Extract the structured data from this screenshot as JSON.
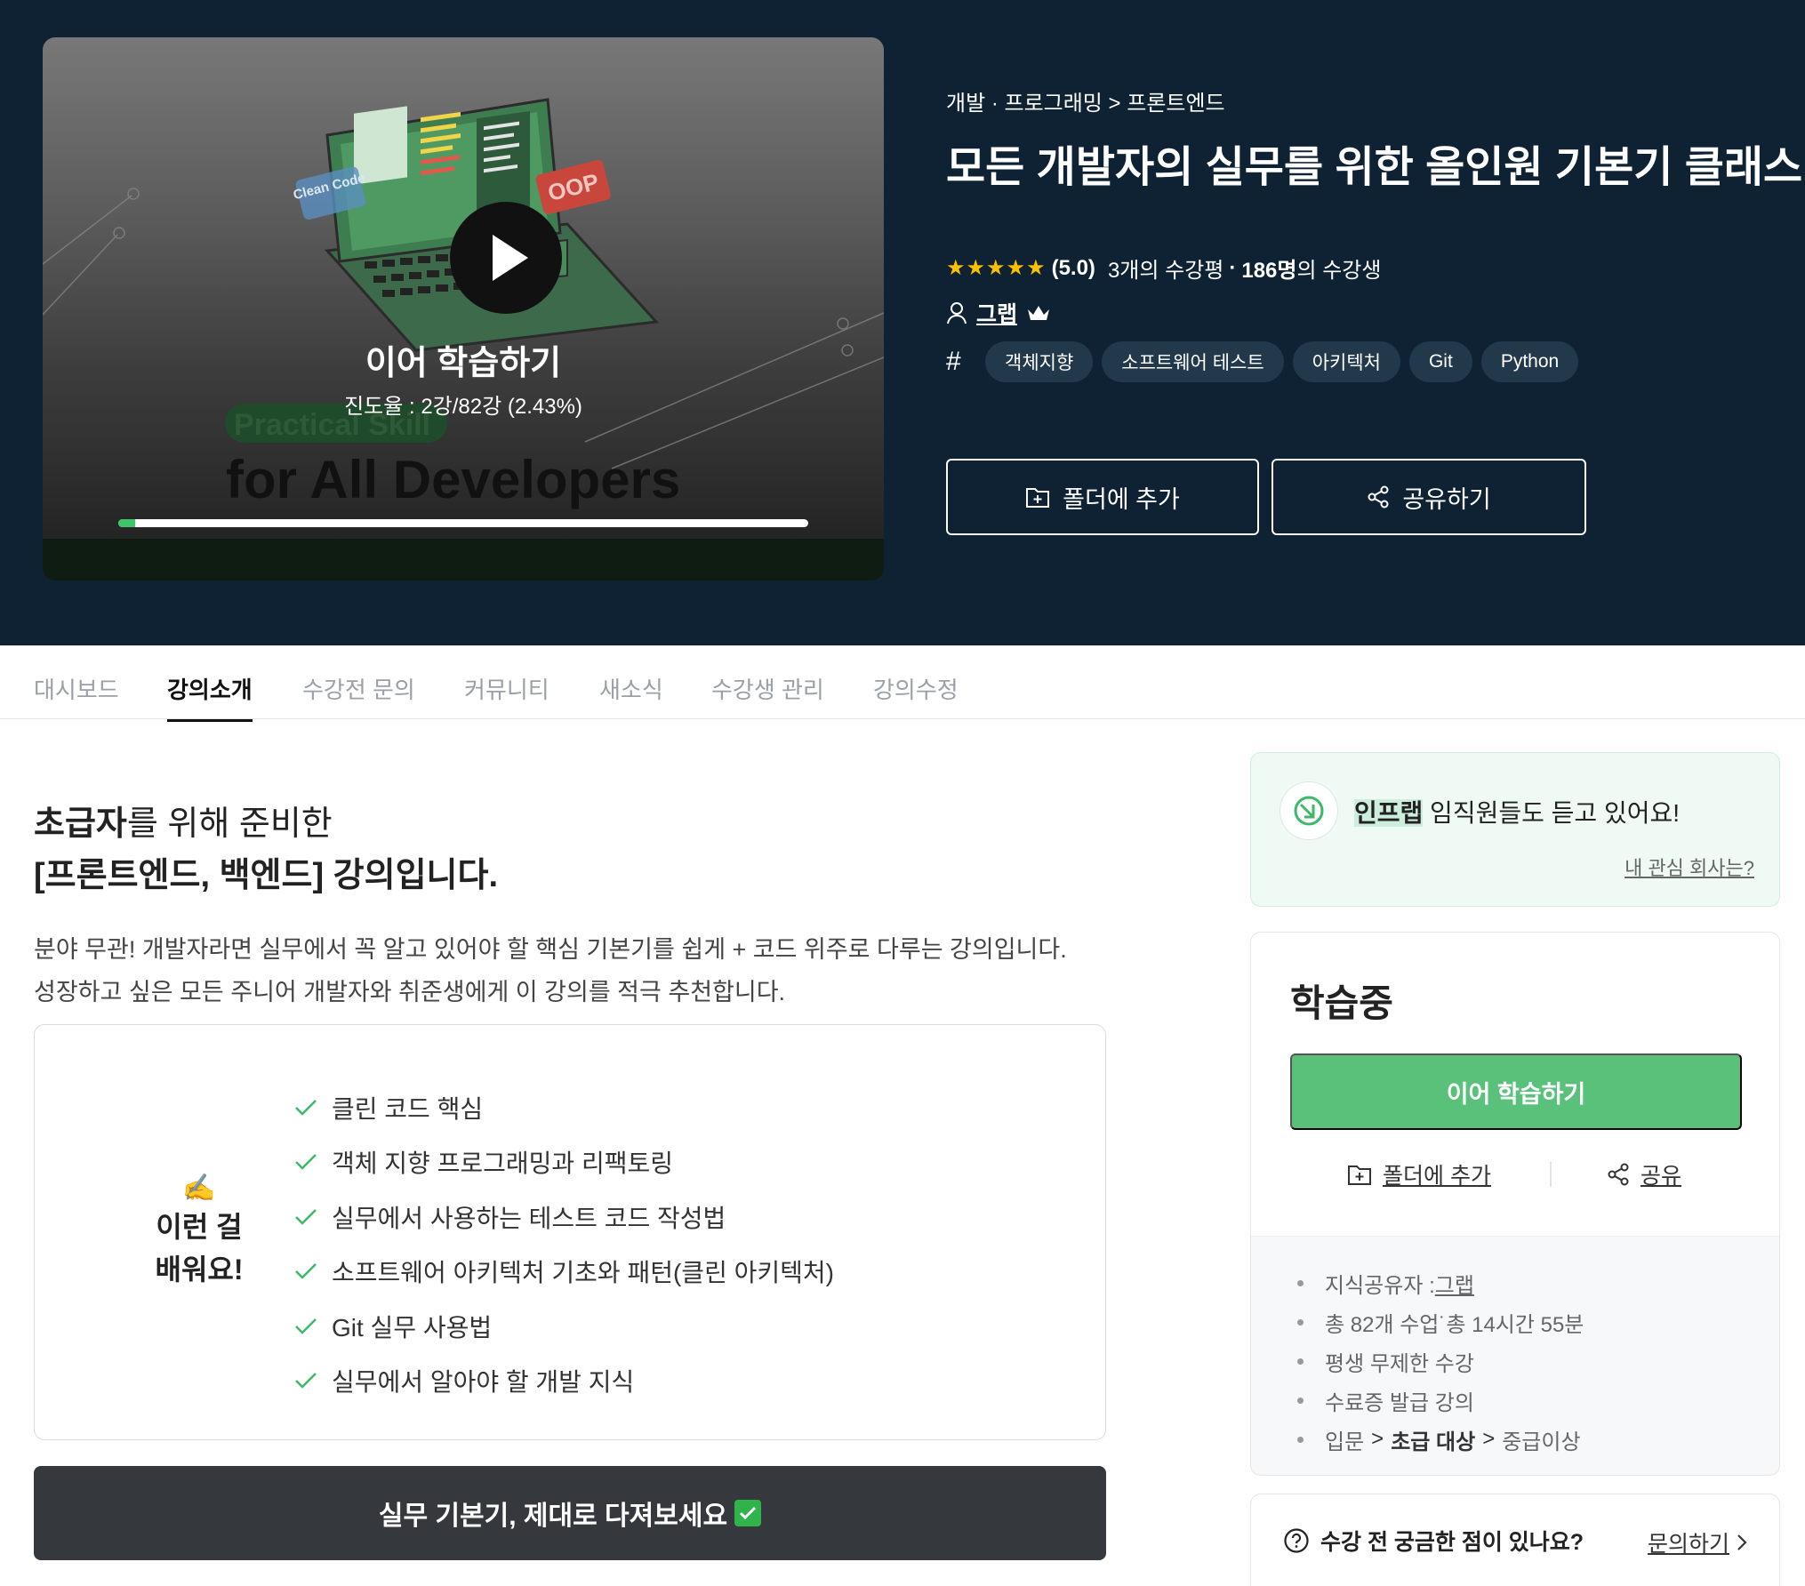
{
  "video": {
    "resume_title": "이어 학습하기",
    "progress_text": "진도율 : 2강/82강 (2.43%)",
    "progress_fraction": 0.0243,
    "art_tag_left": "Clean Code",
    "art_tag_right": "OOP",
    "art_subtitle": "Practical Skill",
    "art_title": "for All Developers"
  },
  "course": {
    "breadcrumb": "개발 · 프로그래밍 > 프론트엔드",
    "title": "모든 개발자의 실무를 위한 올인원 기본기 클래스",
    "stars": "★★★★★",
    "rating": "(5.0)",
    "reviews": "3개의 수강평",
    "dot": "·",
    "students_count": "186명",
    "students_suffix": "의 수강생",
    "author": "그랩",
    "tags": [
      "객체지향",
      "소프트웨어 테스트",
      "아키텍처",
      "Git",
      "Python"
    ],
    "add_folder": "폴더에 추가",
    "share": "공유하기"
  },
  "tabs": [
    "대시보드",
    "강의소개",
    "수강전 문의",
    "커뮤니티",
    "새소식",
    "수강생 관리",
    "강의수정"
  ],
  "active_tab": "강의소개",
  "intro": {
    "headline_bold1": "초급자",
    "headline_rest1": "를 위해 준비한",
    "headline_line2": "[프론트엔드, 백엔드] 강의입니다.",
    "desc_line1": "분야 무관! 개발자라면 실무에서 꼭 알고 있어야 할 핵심 기본기를 쉽게 + 코드 위주로 다루는 강의입니다.",
    "desc_line2": "성장하고 싶은 모든 주니어 개발자와 취준생에게 이 강의를 적극 추천합니다.",
    "learn_emoji": "✍️",
    "learn_label_line1": "이런 걸",
    "learn_label_line2": "배워요!",
    "learn_items": [
      "클린 코드 핵심",
      "객체 지향 프로그래밍과 리팩토링",
      "실무에서 사용하는 테스트 코드 작성법",
      "소프트웨어 아키텍처 기초와 패턴(클린 아키텍처)",
      "Git 실무 사용법",
      "실무에서 알아야 할 개발 지식"
    ],
    "cta": "실무 기본기, 제대로 다져보세요"
  },
  "promo": {
    "company": "인프랩",
    "text": " 임직원들도 듣고 있어요!",
    "link": "내 관심 회사는?"
  },
  "card": {
    "status": "학습중",
    "resume_button": "이어 학습하기",
    "add_folder": "폴더에 추가",
    "share": "공유",
    "instructor_label": "지식공유자 : ",
    "instructor": "그랩",
    "lectures": "총 82개 수업˙총 14시간 55분",
    "lifetime": "평생 무제한 수강",
    "certificate": "수료증 발급 강의",
    "level_1": "입문",
    "level_2": "초급 대상",
    "level_3": "중급이상",
    "chevron": ">"
  },
  "ask": {
    "question": "수강 전 궁금한 점이 있나요?",
    "link": "문의하기"
  },
  "colors": {
    "hero_bg": "#0e2233",
    "accent_green": "#5ac17a",
    "star_yellow": "#fdc000",
    "cta_dark": "#35393d"
  }
}
